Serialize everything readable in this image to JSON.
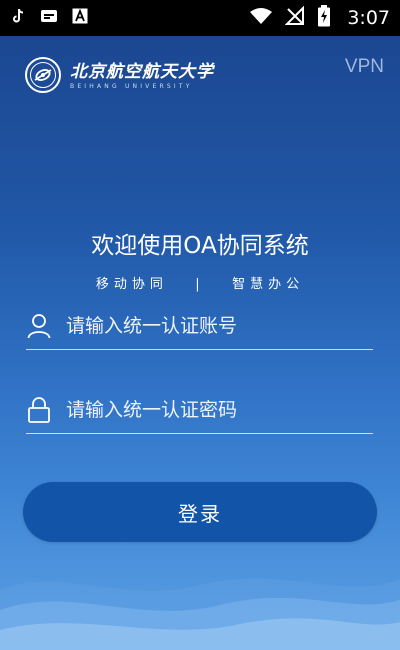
{
  "status_bar": {
    "time": "3:07",
    "left_icons": [
      "tiktok-icon",
      "app-notification-icon",
      "a-badge-icon"
    ],
    "right_icons": [
      "wifi-icon",
      "no-signal-icon",
      "battery-charging-icon"
    ]
  },
  "header": {
    "logo_name": "北京航空航天大学",
    "logo_subtitle": "BEIHANG UNIVERSITY",
    "vpn_label": "VPN"
  },
  "welcome": {
    "title": "欢迎使用OA协同系统",
    "tagline": "移动协同   |   智慧办公"
  },
  "form": {
    "username_placeholder": "请输入统一认证账号",
    "password_placeholder": "请输入统一认证密码",
    "login_label": "登录"
  },
  "colors": {
    "status_bar": "#000000",
    "bg_top": "#1c4791",
    "bg_bottom": "#5da2e4",
    "button": "#1254a7",
    "vpn_text": "#9fb8de"
  }
}
